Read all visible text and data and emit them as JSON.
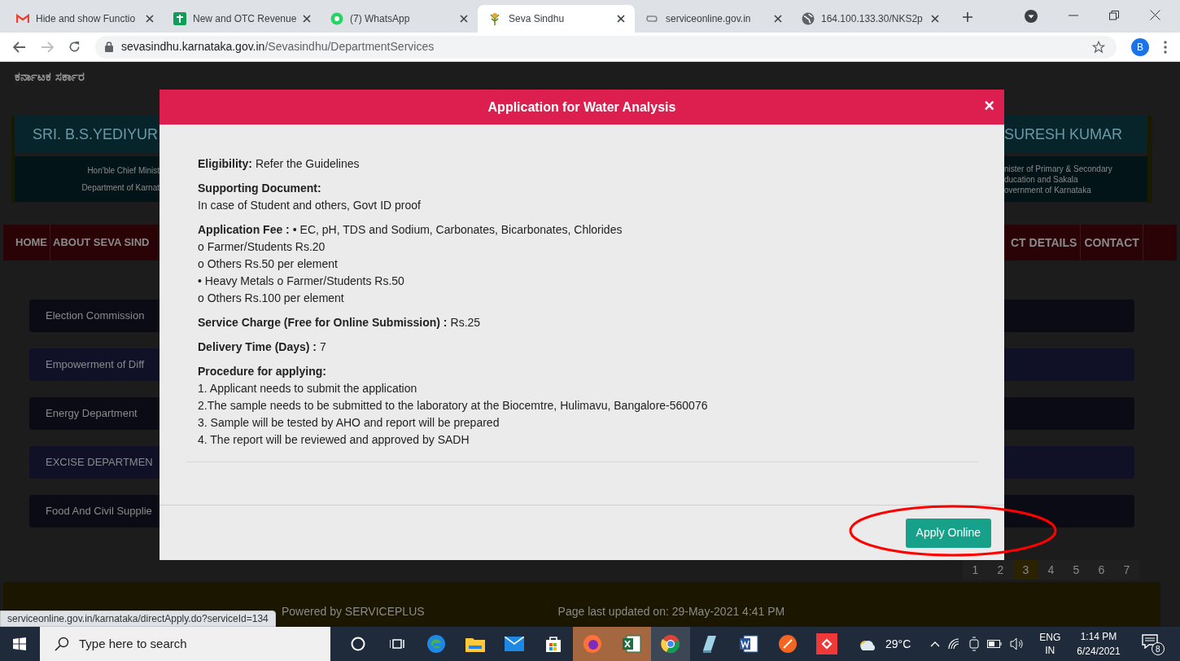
{
  "browser": {
    "tabs": [
      {
        "title": "Hide and show Functio",
        "selected": false
      },
      {
        "title": "New and OTC Revenue",
        "selected": false
      },
      {
        "title": "(7) WhatsApp",
        "selected": false
      },
      {
        "title": "Seva Sindhu",
        "selected": true
      },
      {
        "title": "serviceonline.gov.in",
        "selected": false
      },
      {
        "title": "164.100.133.30/NKS2p",
        "selected": false
      }
    ],
    "url_domain": "sevasindhu.karnataka.gov.in",
    "url_path": "/Sevasindhu/DepartmentServices",
    "profile_initial": "B"
  },
  "background_page": {
    "logo_text": "ಕರ್ನಾಟಕ ಸರ್ಕಾರ",
    "left_banner": {
      "name": "SRI. B.S.YEDIYUR",
      "lines": [
        "Hon'ble Chief Minist",
        "Department of Karnat"
      ]
    },
    "right_banner": {
      "name": "SURESH KUMAR",
      "lines": [
        "nister of Primary & Secondary",
        "ducation and Sakala",
        "overnment of Karnataka"
      ]
    },
    "nav_left": [
      "HOME",
      "ABOUT SEVA SIND"
    ],
    "nav_right": [
      "CT DETAILS",
      "CONTACT"
    ],
    "departments": [
      "Election Commission",
      "Empowerment of Diff",
      "Energy Department",
      "EXCISE DEPARTMEN",
      "Food And Civil Supplie"
    ],
    "pages": [
      {
        "label": "1",
        "selected": false
      },
      {
        "label": "2",
        "selected": false
      },
      {
        "label": "3",
        "selected": true
      },
      {
        "label": "4",
        "selected": false
      },
      {
        "label": "5",
        "selected": false
      },
      {
        "label": "6",
        "selected": false
      },
      {
        "label": "7",
        "selected": false
      }
    ],
    "footer": {
      "powered": "Powered by SERVICEPLUS",
      "updated": "Page last updated on: 29-May-2021 4:41 PM"
    }
  },
  "modal": {
    "title": "Application for Water Analysis",
    "close": "×",
    "sections": [
      {
        "kind": "inline",
        "label": "Eligibility:",
        "lines": [
          "Refer the Guidelines"
        ]
      },
      {
        "kind": "block",
        "label": "Supporting Document:",
        "lines": [
          "In case of Student and others, Govt ID proof"
        ]
      },
      {
        "kind": "inline",
        "label": "Application Fee :",
        "lines": [
          "• EC, pH, TDS and Sodium, Carbonates, Bicarbonates, Chlorides",
          "o Farmer/Students Rs.20",
          "o Others Rs.50 per element",
          "• Heavy Metals o Farmer/Students Rs.50",
          "o Others Rs.100 per element"
        ]
      },
      {
        "kind": "inline",
        "label": "Service Charge (Free for Online Submission) :",
        "lines": [
          "Rs.25"
        ]
      },
      {
        "kind": "inline",
        "label": "Delivery Time (Days) :",
        "lines": [
          "7"
        ]
      },
      {
        "kind": "block",
        "label": "Procedure for applying:",
        "lines": [
          "1. Applicant needs to submit the application",
          "2.The sample needs to be submitted to the laboratory at the Biocemtre, Hulimavu, Bangalore-560076",
          "3. Sample will be tested by AHO and report will be prepared",
          "4. The report will be reviewed and approved by SADH"
        ]
      }
    ],
    "button": "Apply Online"
  },
  "status_url": "serviceonline.gov.in/karnataka/directApply.do?serviceId=134",
  "taskbar": {
    "search_placeholder": "Type here to search",
    "temperature": "29°C",
    "language": [
      "ENG",
      "IN"
    ],
    "time": "1:14 PM",
    "date": "6/24/2021",
    "notifications": "8"
  }
}
